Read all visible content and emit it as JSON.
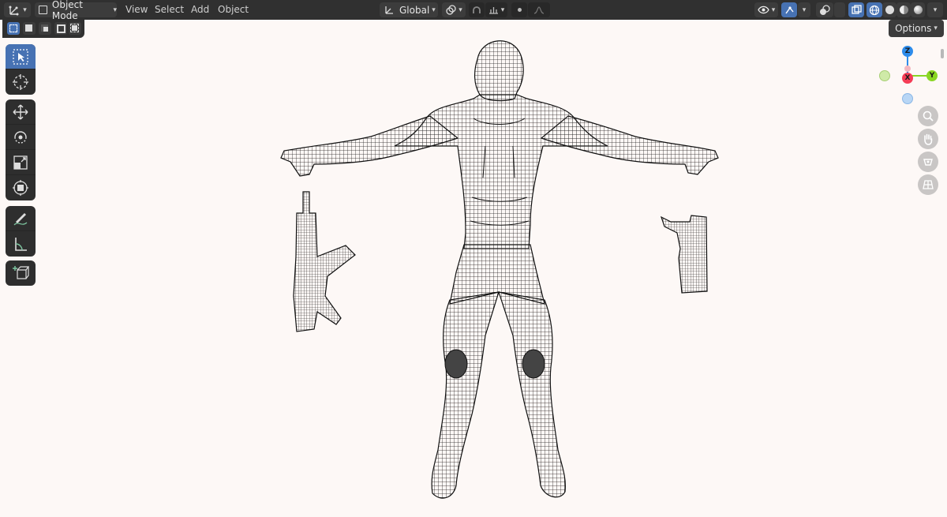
{
  "header": {
    "editor_type_icon": "orientation-icon",
    "mode_label": "Object Mode",
    "menus": [
      "View",
      "Select",
      "Add",
      "Object"
    ],
    "transform_orientation": "Global"
  },
  "viewport": {
    "options_label": "Options",
    "gizmo": {
      "z": "Z",
      "x": "X",
      "y": "Y"
    },
    "background_color": "#fdf8f6"
  },
  "toolbar": {
    "tools": [
      "select-box",
      "cursor",
      "move",
      "rotate",
      "scale",
      "transform",
      "annotate",
      "measure",
      "add-cube"
    ],
    "active_tool": "select-box"
  },
  "colors": {
    "accent": "#4772b3",
    "axis_x": "#f53d56",
    "axis_y": "#89d623",
    "axis_z": "#2d8ceb"
  }
}
